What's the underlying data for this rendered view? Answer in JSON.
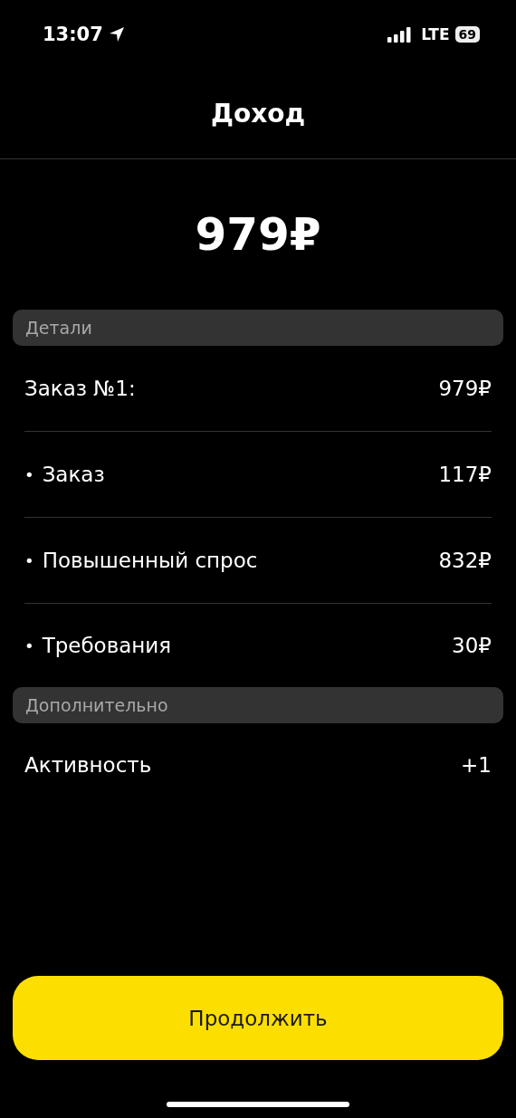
{
  "status_bar": {
    "time": "13:07",
    "network": "LTE",
    "battery": "69"
  },
  "header": {
    "title": "Доход"
  },
  "total": "979₽",
  "sections": [
    {
      "title": "Детали",
      "rows": [
        {
          "kind": "plain",
          "label": "Заказ №1:",
          "value": "979₽"
        },
        {
          "kind": "bullet",
          "bullet": "•",
          "label": "Заказ",
          "value": "117₽"
        },
        {
          "kind": "bullet",
          "bullet": "•",
          "label": "Повышенный спрос",
          "value": "832₽"
        },
        {
          "kind": "bullet",
          "bullet": "•",
          "label": "Требования",
          "value": "30₽"
        }
      ]
    },
    {
      "title": "Дополнительно",
      "rows": [
        {
          "kind": "plain",
          "label": "Активность",
          "value": "+1"
        }
      ]
    }
  ],
  "button": {
    "label": "Продолжить"
  }
}
